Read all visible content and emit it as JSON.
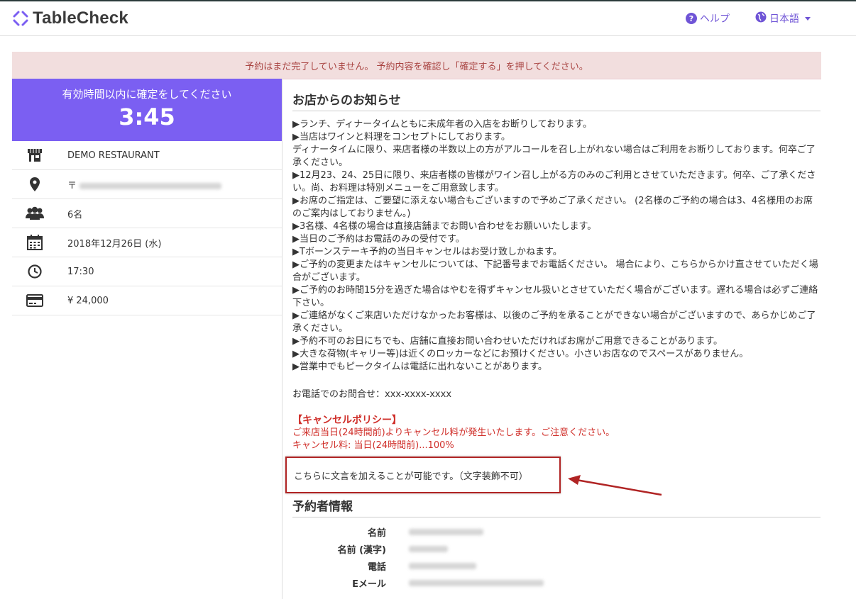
{
  "header": {
    "logo_text": "TableCheck",
    "help_label": "ヘルプ",
    "language_label": "日本語"
  },
  "alert": {
    "message": "予約はまだ完了していません。 予約内容を確認し「確定する」を押してください。"
  },
  "timer": {
    "message": "有効時間以内に確定をしてください",
    "value": "3:45"
  },
  "sidebar": {
    "restaurant": "DEMO RESTAURANT",
    "address_prefix": "〒",
    "guests": "6名",
    "date": "2018年12月26日 (水)",
    "time": "17:30",
    "price": "¥ 24,000"
  },
  "notice": {
    "title": "お店からのお知らせ",
    "lines": [
      "▶ランチ、ディナータイムともに未成年者の入店をお断りしております。",
      "▶当店はワインと料理をコンセプトにしております。",
      "ディナータイムに限り、来店者様の半数以上の方がアルコールを召し上がれない場合はご利用をお断りしております。何卒ご了承ください。",
      "▶12月23、24、25日に限り、来店者様の皆様がワイン召し上がる方のみのご利用とさせていただきます。何卒、ご了承ください。尚、お料理は特別メニューをご用意致します。",
      "▶お席のご指定は、ご要望に添えない場合もございますので予めご了承ください。 (2名様のご予約の場合は3、4名様用のお席のご案内はしておりません。)",
      "▶3名様、4名様の場合は直接店舗までお問い合わせをお願いいたします。",
      "▶当日のご予約はお電話のみの受付です。",
      "▶Tボーンステーキ予約の当日キャンセルはお受け致しかねます。",
      "▶ご予約の変更またはキャンセルについては、下記番号までお電話ください。 場合により、こちらからかけ直させていただく場合がございます。",
      "▶ご予約のお時間15分を過ぎた場合はやむを得ずキャンセル扱いとさせていただく場合がございます。遅れる場合は必ずご連絡下さい。",
      "▶ご連絡がなくご来店いただけなかったお客様は、以後のご予約を承ることができない場合がございますので、あらかじめご了承ください。",
      "▶予約不可のお日にちでも、店舗に直接お問い合わせいただければお席がご用意できることがあります。",
      "▶大きな荷物(キャリー等)は近くのロッカーなどにお預けください。小さいお店なのでスペースがありません。",
      "▶営業中でもピークタイムは電話に出れないことがあります。"
    ],
    "contact": "お電話でのお問合せ：xxx-xxxx-xxxx"
  },
  "cancel_policy": {
    "title": "【キャンセルポリシー】",
    "line1": "ご来店当日(24時間前)よりキャンセル料が発生いたします。ご注意ください。",
    "line2": "キャンセル料: 当日(24時間前)...100%"
  },
  "extra_text": "こちらに文言を加えることが可能です。（文字装飾不可）",
  "reserver": {
    "title": "予約者情報",
    "labels": [
      "名前",
      "名前 (漢字)",
      "電話",
      "Eメール"
    ]
  },
  "colors": {
    "accent": "#7b5ff2",
    "link": "#6f54d6",
    "alert_bg": "#f2dede",
    "alert_text": "#a94442",
    "cancel_text": "#d0302b",
    "highlight_border": "#b02424"
  }
}
